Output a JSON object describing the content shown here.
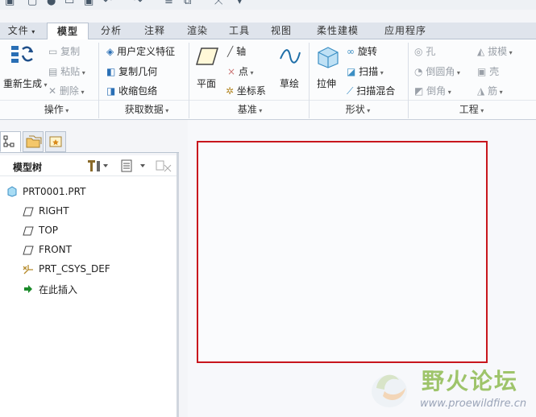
{
  "tabs": [
    {
      "label": "文件",
      "has_arrow": true
    },
    {
      "label": "模型"
    },
    {
      "label": "分析"
    },
    {
      "label": "注释"
    },
    {
      "label": "渲染"
    },
    {
      "label": "工具"
    },
    {
      "label": "视图"
    },
    {
      "label": "柔性建模"
    },
    {
      "label": "应用程序"
    }
  ],
  "ribbon": {
    "operations": {
      "regenerate": "重新生成",
      "copy": "复制",
      "paste": "粘贴",
      "delete": "删除",
      "label": "操作"
    },
    "get_data": {
      "udf": "用户定义特征",
      "copy_geometry": "复制几何",
      "shrinkwrap": "收缩包络",
      "label": "获取数据"
    },
    "datum": {
      "plane": "平面",
      "axis": "轴",
      "point": "点",
      "csys": "坐标系",
      "sketch": "草绘",
      "label": "基准"
    },
    "shapes": {
      "extrude": "拉伸",
      "revolve": "旋转",
      "sweep": "扫描",
      "swept_blend": "扫描混合",
      "label": "形状"
    },
    "engineering": {
      "hole": "孔",
      "round": "倒圆角",
      "chamfer": "倒角",
      "draft": "拔模",
      "shell": "壳",
      "rib": "筋",
      "label": "工程"
    }
  },
  "model_tree": {
    "title": "模型树",
    "items": [
      {
        "label": "PRT0001.PRT",
        "icon": "part-icon"
      },
      {
        "label": "RIGHT",
        "icon": "datum-plane-icon"
      },
      {
        "label": "TOP",
        "icon": "datum-plane-icon"
      },
      {
        "label": "FRONT",
        "icon": "datum-plane-icon"
      },
      {
        "label": "PRT_CSYS_DEF",
        "icon": "csys-icon"
      },
      {
        "label": "在此插入",
        "icon": "insert-here-icon"
      }
    ]
  },
  "watermark": {
    "title": "野火论坛",
    "url": "www.proewildfire.cn"
  },
  "colors": {
    "highlight_box": "#c8161d",
    "insert_arrow": "#1a8a2a",
    "watermark_green": "#9ec46a"
  }
}
